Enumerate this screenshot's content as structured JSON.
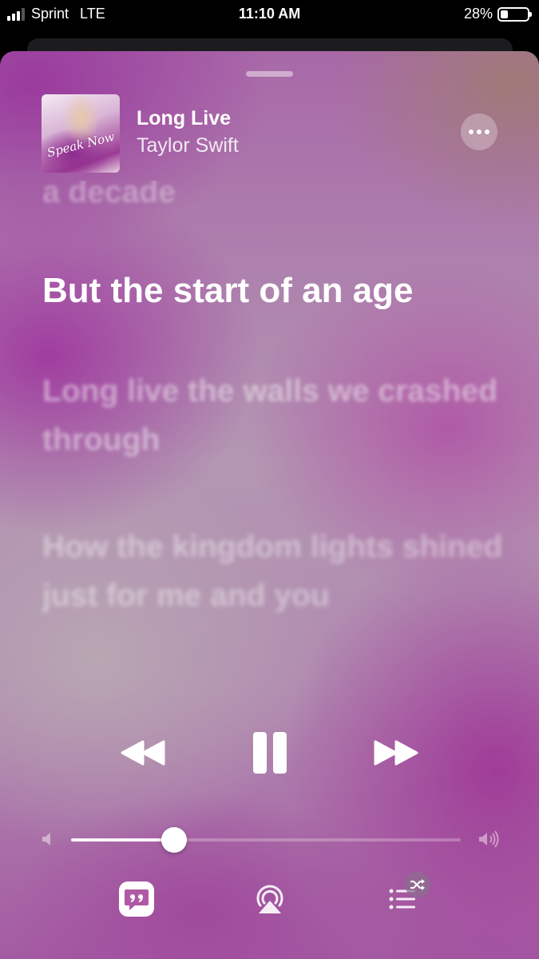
{
  "status_bar": {
    "carrier": "Sprint",
    "network": "LTE",
    "time": "11:10 AM",
    "battery_percent": "28%",
    "battery_level": 0.28,
    "signal_bars_active": 3,
    "signal_bars_total": 4
  },
  "now_playing": {
    "title": "Long Live",
    "artist": "Taylor Swift",
    "artwork_text": "Speak Now"
  },
  "lyrics": {
    "previous": "a decade",
    "current": "But the start of an age",
    "next": "Long live the walls we crashed through",
    "next2": "How the kingdom lights shined just for me and you"
  },
  "controls": {
    "rewind_icon": "rewind-icon",
    "pause_icon": "pause-icon",
    "fast_forward_icon": "fast-forward-icon"
  },
  "volume": {
    "level": 0.265
  },
  "bottom_bar": {
    "lyrics_icon": "lyrics-quote-icon",
    "airplay_icon": "airplay-audio-icon",
    "queue_icon": "queue-list-icon",
    "shuffle_badge_icon": "shuffle-icon"
  },
  "colors": {
    "accent_magenta": "#a03ca0",
    "text": "#ffffff"
  }
}
